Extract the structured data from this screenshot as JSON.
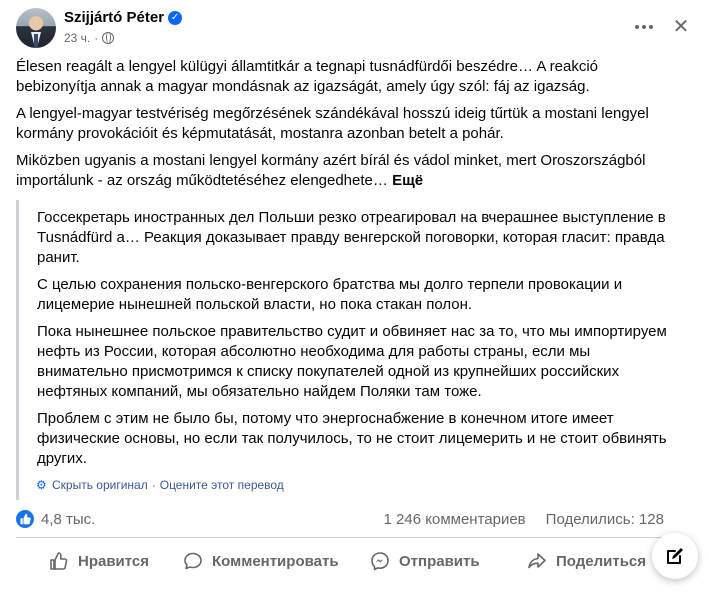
{
  "post": {
    "author": "Szijjártó Péter",
    "time": "23 ч.",
    "paragraphs": [
      "Élesen reagált a lengyel külügyi államtitkár a tegnapi tusnádfürdői beszédre… A reakció bebizonyítja annak a magyar mondásnak az igazságát, amely úgy szól: fáj az igazság.",
      "A lengyel-magyar testvériség megőrzésének szándékával hosszú ideig tűrtük a mostani lengyel kormány provokációit és képmutatását, mostanra azonban betelt a pohár.",
      "Miközben ugyanis a mostani lengyel kormány azért bírál és vádol minket, mert Oroszországból importálunk - az ország működtetéséhez elengedhete…"
    ],
    "see_more": "Ещё"
  },
  "translation": {
    "paragraphs": [
      "Госсекретарь иностранных дел Польши резко отреагировал на вчерашнее выступление в Tusnádfürd а… Реакция доказывает правду венгерской поговорки, которая гласит: правда ранит.",
      "С целью сохранения польско-венгерского братства мы долго терпели провокации и лицемерие нынешней польской власти, но пока стакан полон.",
      "Пока нынешнее польское правительство судит и обвиняет нас за то, что мы импортируем нефть из России, которая абсолютно необходима для работы страны, если мы внимательно присмотримся к списку покупателей одной из крупнейших российских нефтяных компаний, мы обязательно найдем Поляки там тоже.",
      "Проблем с этим не было бы, потому что энергоснабжение в конечном итоге имеет физические основы, но если так получилось, то не стоит лицемерить и не стоит обвинять других."
    ],
    "hide_original": "Скрыть оригинал",
    "separator": "·",
    "rate": "Оцените этот перевод"
  },
  "stats": {
    "likes": "4,8 тыс.",
    "comments": "1 246 комментариев",
    "shares": "Поделились: 128"
  },
  "actions": {
    "like": "Нравится",
    "comment": "Комментировать",
    "share": "Отправить",
    "send": "Поделиться"
  },
  "colors": {
    "accent": "#0866ff",
    "like_badge": "#1b74e4",
    "secondary_text": "#65676b",
    "divider": "#ced0d4"
  }
}
